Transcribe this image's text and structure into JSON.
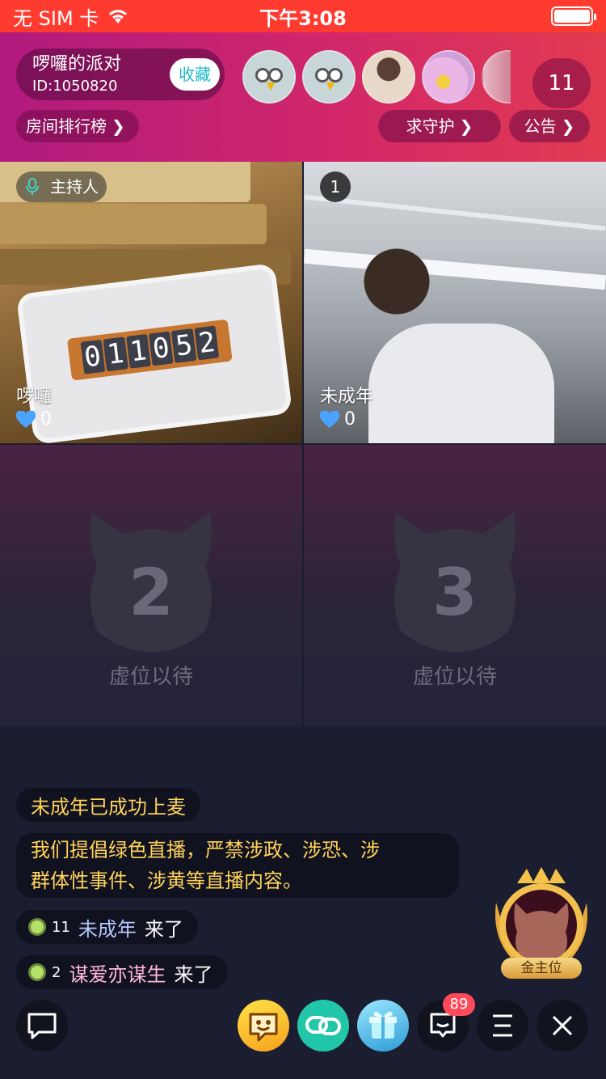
{
  "status_bar": {
    "carrier": "无 SIM 卡",
    "time": "下午3:08"
  },
  "header": {
    "room_name": "啰囉的派对",
    "room_id": "ID:1050820",
    "favorite_label": "收藏",
    "online_count": "11",
    "rank_label": "房间排行榜",
    "guard_label": "求守护",
    "notice_label": "公告"
  },
  "seats": {
    "host_tag": "主持人",
    "host": {
      "name": "啰囉",
      "hearts": "0"
    },
    "seat1": {
      "badge": "1",
      "name": "未成年",
      "hearts": "0"
    },
    "timer_display": [
      "0",
      "1",
      "1",
      "0",
      "5",
      "2"
    ],
    "empty": [
      {
        "number": "2",
        "label": "虚位以待"
      },
      {
        "number": "3",
        "label": "虚位以待"
      }
    ]
  },
  "chat": {
    "system_message": "未成年已成功上麦",
    "rules_line1": "我们提倡绿色直播，严禁涉政、涉恐、涉",
    "rules_line2": "群体性事件、涉黄等直播内容。",
    "joins": [
      {
        "level": "11",
        "name": "未成年",
        "suffix": "来了"
      },
      {
        "level": "2",
        "name": "谋爱亦谋生",
        "suffix": "来了"
      }
    ]
  },
  "gold_seat": {
    "label": "金主位"
  },
  "bottom_bar": {
    "message_badge": "89"
  },
  "colors": {
    "status_bar": "#ff3b30",
    "header_start": "#b01a7e",
    "header_end": "#e23a4f",
    "favorite_text": "#1fb9c9",
    "system_text": "#ffd25a",
    "heart": "#4aa3ff"
  }
}
